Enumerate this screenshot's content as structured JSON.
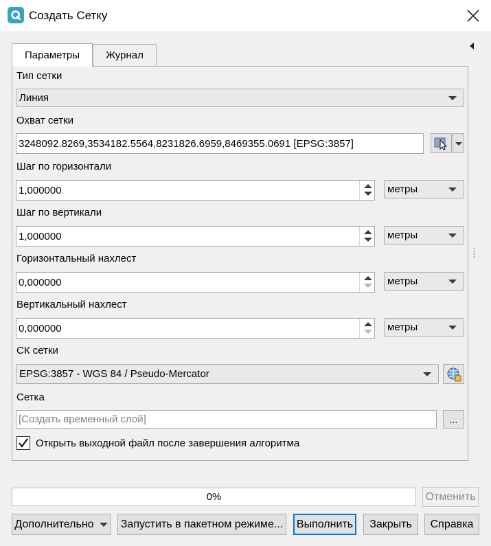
{
  "window": {
    "title": "Создать Сетку"
  },
  "tabs": [
    {
      "label": "Параметры",
      "active": true
    },
    {
      "label": "Журнал",
      "active": false
    }
  ],
  "params": {
    "grid_type": {
      "label": "Тип сетки",
      "value": "Линия"
    },
    "extent": {
      "label": "Охват сетки",
      "value": "3248092.8269,3534182.5564,8231826.6959,8469355.0691 [EPSG:3857]"
    },
    "h_spacing": {
      "label": "Шаг по горизонтали",
      "value": "1,000000",
      "unit": "метры"
    },
    "v_spacing": {
      "label": "Шаг по вертикали",
      "value": "1,000000",
      "unit": "метры"
    },
    "h_overlay": {
      "label": "Горизонтальный нахлест",
      "value": "0,000000",
      "unit": "метры"
    },
    "v_overlay": {
      "label": "Вертикальный нахлест",
      "value": "0,000000",
      "unit": "метры"
    },
    "crs": {
      "label": "СК сетки",
      "value": "EPSG:3857 - WGS 84 / Pseudo-Mercator"
    },
    "output": {
      "label": "Сетка",
      "placeholder": "[Создать временный слой]",
      "browse": "..."
    },
    "open_output": {
      "label": "Открыть выходной файл после завершения алгоритма",
      "checked": true
    }
  },
  "progress": {
    "text": "0%",
    "value": 0
  },
  "buttons": {
    "cancel": "Отменить",
    "advanced": "Дополнительно",
    "batch": "Запустить в пакетном режиме...",
    "run": "Выполнить",
    "close": "Закрыть",
    "help": "Справка"
  }
}
